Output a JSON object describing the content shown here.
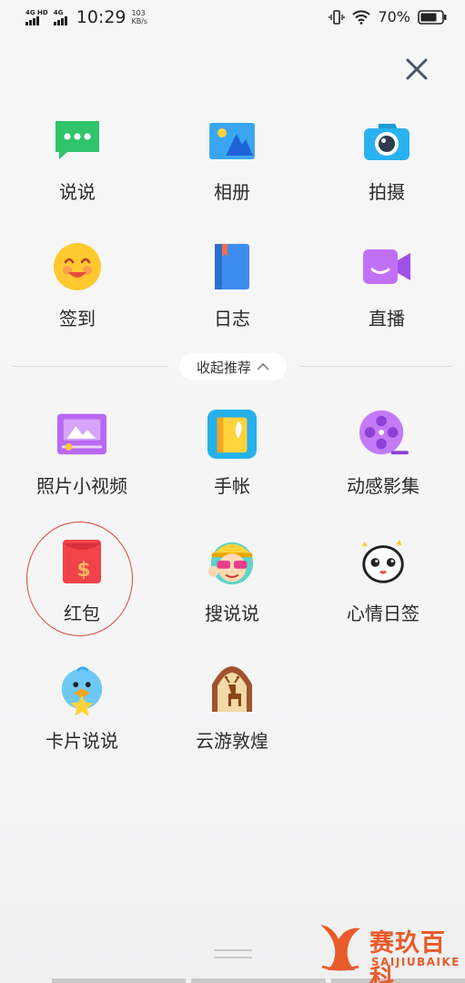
{
  "status_bar": {
    "sim1": "4G HD",
    "sim2": "4G",
    "time": "10:29",
    "speed_value": "103",
    "speed_unit": "KB/s",
    "battery": "70%"
  },
  "top_grid": [
    {
      "label": "说说",
      "icon": "chat-bubble-icon"
    },
    {
      "label": "相册",
      "icon": "album-icon"
    },
    {
      "label": "拍摄",
      "icon": "camera-icon"
    },
    {
      "label": "签到",
      "icon": "smiley-icon"
    },
    {
      "label": "日志",
      "icon": "journal-icon"
    },
    {
      "label": "直播",
      "icon": "live-video-icon"
    }
  ],
  "collapse": {
    "label": "收起推荐"
  },
  "recommended": [
    {
      "label": "照片小视频",
      "icon": "photo-video-icon"
    },
    {
      "label": "手帐",
      "icon": "notebook-icon"
    },
    {
      "label": "动感影集",
      "icon": "film-reel-icon"
    },
    {
      "label": "红包",
      "icon": "red-envelope-icon"
    },
    {
      "label": "搜说说",
      "icon": "sunglasses-avatar-icon"
    },
    {
      "label": "心情日签",
      "icon": "mood-face-icon"
    },
    {
      "label": "卡片说说",
      "icon": "bird-card-icon"
    },
    {
      "label": "云游敦煌",
      "icon": "dunhuang-deer-icon"
    }
  ],
  "watermark": {
    "main": "赛玖百科",
    "sub": "SAIJIUBAIKE"
  },
  "colors": {
    "accent_red": "#d8453f",
    "green": "#2fc46a",
    "blue": "#3d8cf0",
    "purple": "#b56cf0",
    "watermark": "#e95b2a"
  }
}
